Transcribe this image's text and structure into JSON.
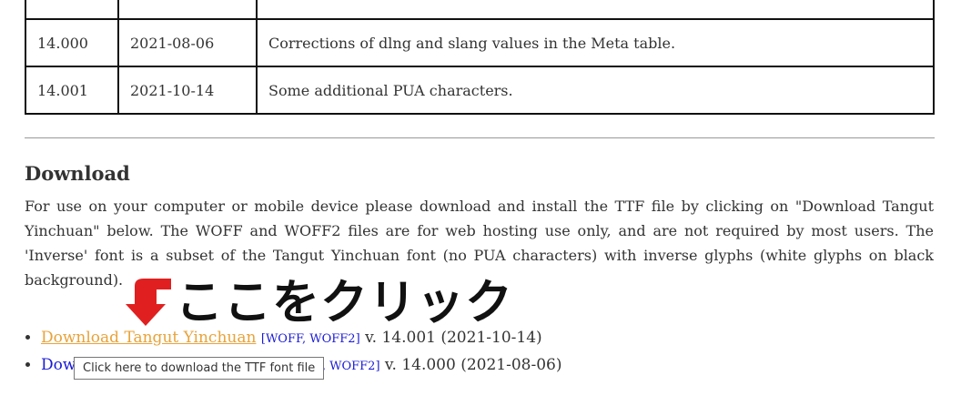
{
  "table": {
    "rows": [
      {
        "version": "14.000",
        "date": "2021-08-06",
        "note": "Corrections of dlng and slang values in the Meta table."
      },
      {
        "version": "14.001",
        "date": "2021-10-14",
        "note": "Some additional PUA characters."
      }
    ]
  },
  "download": {
    "heading": "Download",
    "description": "For use on your computer or mobile device please download and install the TTF file by clicking on \"Download Tangut Yinchuan\" below. The WOFF and WOFF2 files are for web hosting use only, and are not required by most users. The 'Inverse' font is a subset of the Tangut Yinchuan font (no PUA characters) with inverse glyphs (white glyphs on black background).",
    "callout_text": "ここをクリック",
    "items": [
      {
        "link": "Download Tangut Yinchuan",
        "open": "[",
        "woff": "WOFF",
        "comma": ", ",
        "woff2": "WOFF2",
        "close": "]",
        "version": " v. 14.001 (2021-10-14)"
      },
      {
        "link": "Dow",
        "open": "",
        "woff": "F",
        "comma": ", ",
        "woff2": "WOFF2",
        "close": "]",
        "version": " v. 14.000 (2021-08-06)"
      }
    ]
  },
  "tooltip": "Click here to download the TTF font file",
  "colors": {
    "link_visited": "#e8a33a",
    "link": "#1a1ad6",
    "arrow": "#e02020"
  }
}
